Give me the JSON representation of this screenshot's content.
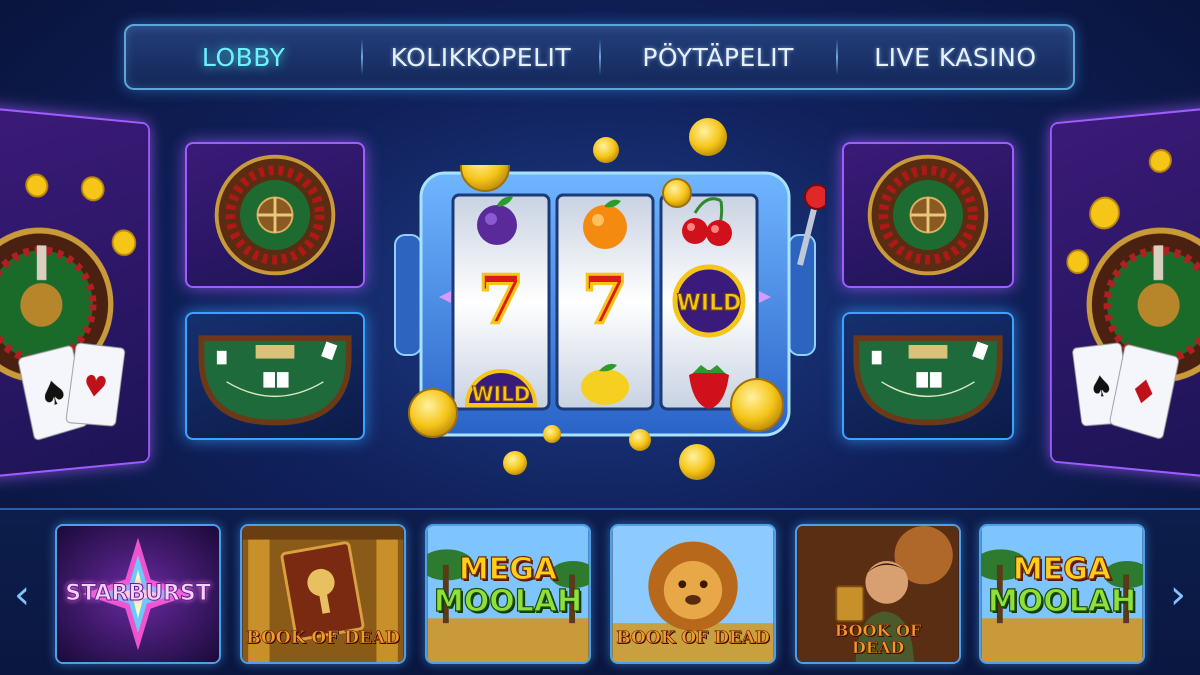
{
  "nav": {
    "tabs": [
      {
        "label": "LOBBY",
        "active": true
      },
      {
        "label": "KOLIKKOPELIT",
        "active": false
      },
      {
        "label": "PÖYTÄPELIT",
        "active": false
      },
      {
        "label": "LIVE KASINO",
        "active": false
      }
    ]
  },
  "slot_machine": {
    "reels": [
      [
        "plum",
        "seven",
        "wild"
      ],
      [
        "orange",
        "seven",
        "lemon"
      ],
      [
        "cherry",
        "wild",
        "strawberry"
      ]
    ],
    "seven_label": "7",
    "wild_label": "WILD"
  },
  "side_panels": {
    "left": [
      "roulette-and-cards",
      "roulette-wheel",
      "blackjack-table"
    ],
    "right": [
      "roulette-wheel",
      "blackjack-table",
      "roulette-and-cards"
    ]
  },
  "carousel": {
    "prev_icon": "‹",
    "next_icon": "›",
    "games": [
      {
        "title": "STARBURST",
        "theme": "starburst"
      },
      {
        "title": "BOOK OF DEAD",
        "theme": "book-of-dead"
      },
      {
        "title_line1": "MEGA",
        "title_line2": "MOOLAH",
        "theme": "mega-moolah"
      },
      {
        "title": "BOOK OF DEAD",
        "theme": "book-of-dead-lion"
      },
      {
        "title_line1": "BOOK OF",
        "title_line2": "DEAD",
        "theme": "book-of-dead-hero"
      },
      {
        "title_line1": "MEGA",
        "title_line2": "MOOLAH",
        "theme": "mega-moolah"
      }
    ]
  },
  "colors": {
    "accent_cyan": "#6ff0ff",
    "panel_purple": "#a05cff",
    "panel_blue": "#3aa3ff",
    "gold": "#f5c518"
  }
}
